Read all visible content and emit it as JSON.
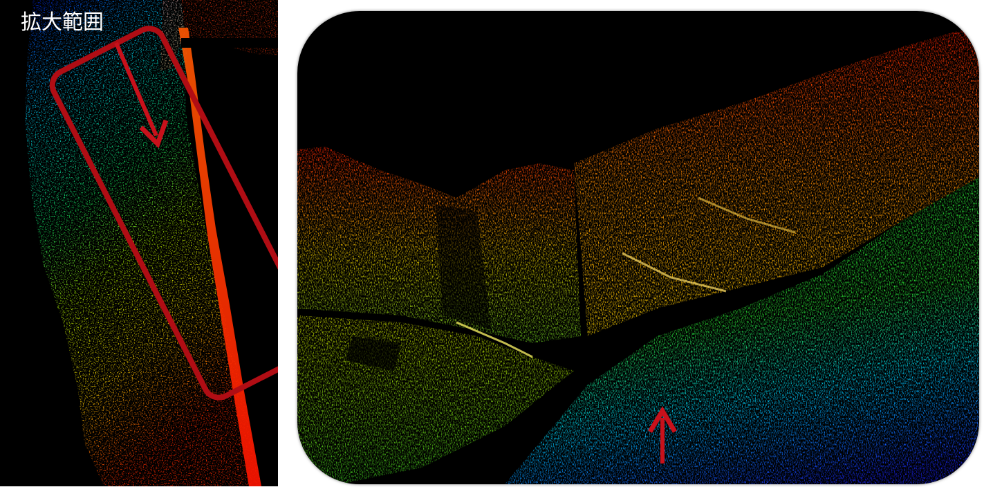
{
  "left_panel": {
    "label": "拡大範囲",
    "colors": {
      "highlight_frame": "#b00d14",
      "arrow": "#c8111b",
      "gradient": [
        "#0a1bff",
        "#00d7ff",
        "#17e45c",
        "#b4f000",
        "#ffd600",
        "#ff1e00"
      ]
    }
  },
  "right_panel": {
    "colors": {
      "arrow": "#c8111b",
      "cliff": [
        "#ff1a00",
        "#ff8c00",
        "#ffd800"
      ],
      "ground": [
        "#2adf34",
        "#00d6ff",
        "#1a25ff"
      ]
    }
  }
}
